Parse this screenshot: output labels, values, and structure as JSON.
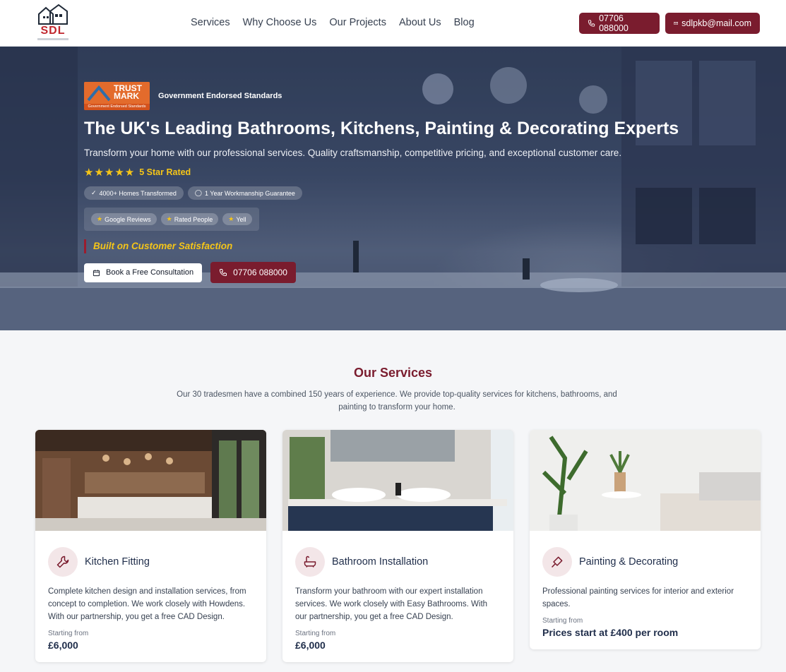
{
  "header": {
    "logo_text": "SDL",
    "nav": [
      "Services",
      "Why Choose Us",
      "Our Projects",
      "About Us",
      "Blog"
    ],
    "phone": "07706 088000",
    "email": "sdlpkb@mail.com"
  },
  "hero": {
    "trustmark_word": "TRUST MARK",
    "trustmark_bar": "Government Endorsed Standards",
    "trust_label": "Government Endorsed Standards",
    "title": "The UK's Leading Bathrooms, Kitchens, Painting & Decorating Experts",
    "subtitle": "Transform your home with our professional services. Quality craftsmanship, competitive pricing, and exceptional customer care.",
    "stars": "★★★★★",
    "rating_label": "5 Star Rated",
    "badges": [
      "4000+ Homes Transformed",
      "1 Year Workmanship Guarantee"
    ],
    "reviews": [
      "Google Reviews",
      "Rated People",
      "Yell"
    ],
    "slogan": "Built on Customer Satisfaction",
    "cta_primary": "Book a Free Consultation",
    "cta_phone": "07706 088000"
  },
  "services": {
    "title": "Our Services",
    "description": "Our 30 tradesmen have a combined 150 years of experience. We provide top-quality services for kitchens, bathrooms, and painting to transform your home.",
    "cards": [
      {
        "title": "Kitchen Fitting",
        "icon": "wrench-icon",
        "text": "Complete kitchen design and installation services, from concept to completion. We work closely with Howdens. With our partnership, you get a free CAD Design.",
        "from_label": "Starting from",
        "price": "£6,000"
      },
      {
        "title": "Bathroom Installation",
        "icon": "bathtub-icon",
        "text": "Transform your bathroom with our expert installation services. We work closely with Easy Bathrooms. With our partnership, you get a free CAD Design.",
        "from_label": "Starting from",
        "price": "£6,000"
      },
      {
        "title": "Painting & Decorating",
        "icon": "paintbrush-icon",
        "text": "Professional painting services for interior and exterior spaces.",
        "from_label": "Starting from",
        "price": "Prices start at £400 per room"
      }
    ]
  }
}
